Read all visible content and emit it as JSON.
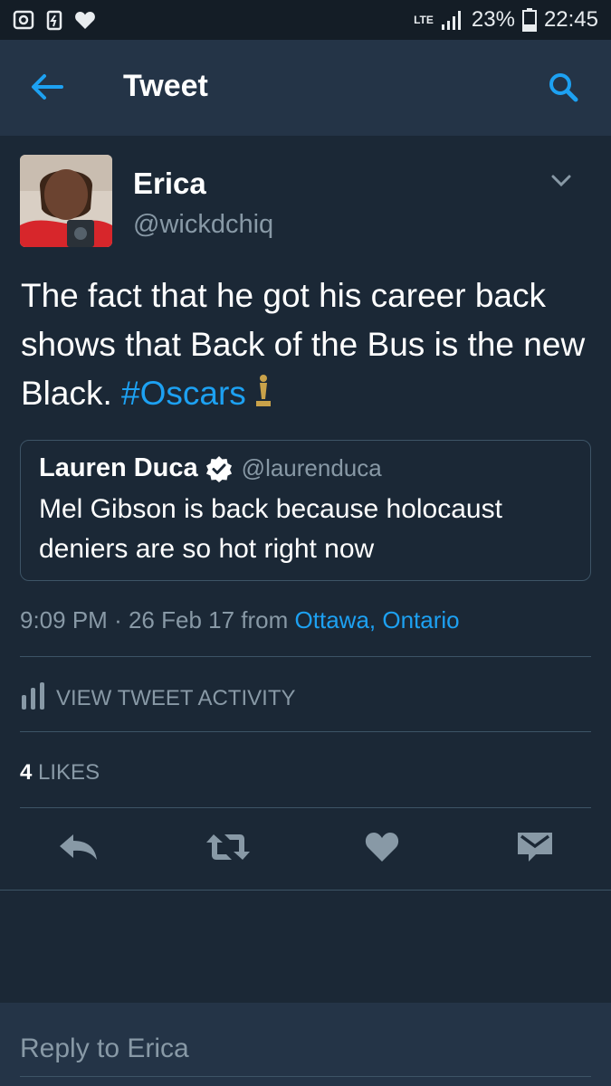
{
  "status_bar": {
    "network": "LTE",
    "battery": "23%",
    "time": "22:45"
  },
  "header": {
    "title": "Tweet"
  },
  "tweet": {
    "author_name": "Erica",
    "author_handle": "@wickdchiq",
    "text": "The fact that he got his career back shows that Back of the Bus is the new Black.",
    "hashtag": "#Oscars",
    "quoted": {
      "name": "Lauren Duca",
      "handle": "@laurenduca",
      "text": "Mel Gibson is back because holocaust deniers are so hot right now"
    },
    "time": "9:09 PM",
    "date": "26 Feb 17",
    "from_label": "from",
    "location": "Ottawa, Ontario",
    "activity_label": "VIEW TWEET ACTIVITY",
    "likes_count": "4",
    "likes_label": "LIKES"
  },
  "reply": {
    "placeholder": "Reply to Erica"
  },
  "icons": {
    "back": "arrow-left-icon",
    "search": "search-icon",
    "caret": "chevron-down-icon",
    "verified": "verified-badge-icon",
    "oscar": "oscar-statuette-icon",
    "activity": "bar-chart-icon",
    "reply": "reply-icon",
    "retweet": "retweet-icon",
    "like": "heart-icon",
    "dm": "envelope-icon"
  },
  "colors": {
    "background": "#1b2836",
    "header": "#243447",
    "accent": "#1da1f2",
    "muted": "#8899a6",
    "divider": "#3d5466"
  }
}
